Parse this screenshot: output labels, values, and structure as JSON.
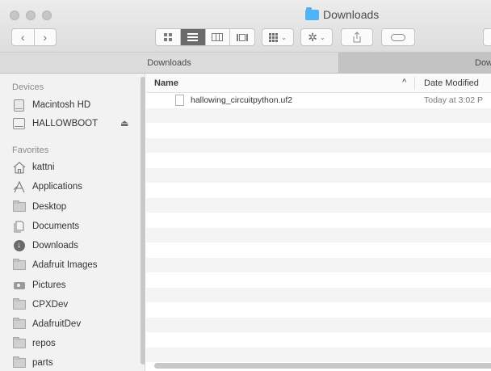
{
  "window": {
    "title": "Downloads"
  },
  "tabs": [
    {
      "label": "Downloads"
    },
    {
      "label": "Dow"
    }
  ],
  "sidebar": {
    "devices_heading": "Devices",
    "devices": [
      {
        "label": "Macintosh HD",
        "icon": "internal-disk-icon"
      },
      {
        "label": "HALLOWBOOT",
        "icon": "external-drive-icon",
        "eject": "⏏"
      }
    ],
    "favorites_heading": "Favorites",
    "favorites": [
      {
        "label": "kattni",
        "icon": "home-icon"
      },
      {
        "label": "Applications",
        "icon": "applications-icon"
      },
      {
        "label": "Desktop",
        "icon": "desktop-icon"
      },
      {
        "label": "Documents",
        "icon": "documents-icon"
      },
      {
        "label": "Downloads",
        "icon": "downloads-icon"
      },
      {
        "label": "Adafruit Images",
        "icon": "folder-icon"
      },
      {
        "label": "Pictures",
        "icon": "pictures-icon"
      },
      {
        "label": "CPXDev",
        "icon": "folder-icon"
      },
      {
        "label": "AdafruitDev",
        "icon": "folder-icon"
      },
      {
        "label": "repos",
        "icon": "folder-icon"
      },
      {
        "label": "parts",
        "icon": "folder-icon"
      }
    ]
  },
  "list": {
    "columns": {
      "name": "Name",
      "date_modified": "Date Modified"
    },
    "files": [
      {
        "name": "hallowing_circuitpython.uf2",
        "date": "Today at 3:02 P",
        "icon": "document-icon"
      }
    ]
  },
  "toolbar": {
    "back_glyph": "‹",
    "forward_glyph": "›",
    "action_glyph": "✲",
    "chevron": "⌄"
  }
}
